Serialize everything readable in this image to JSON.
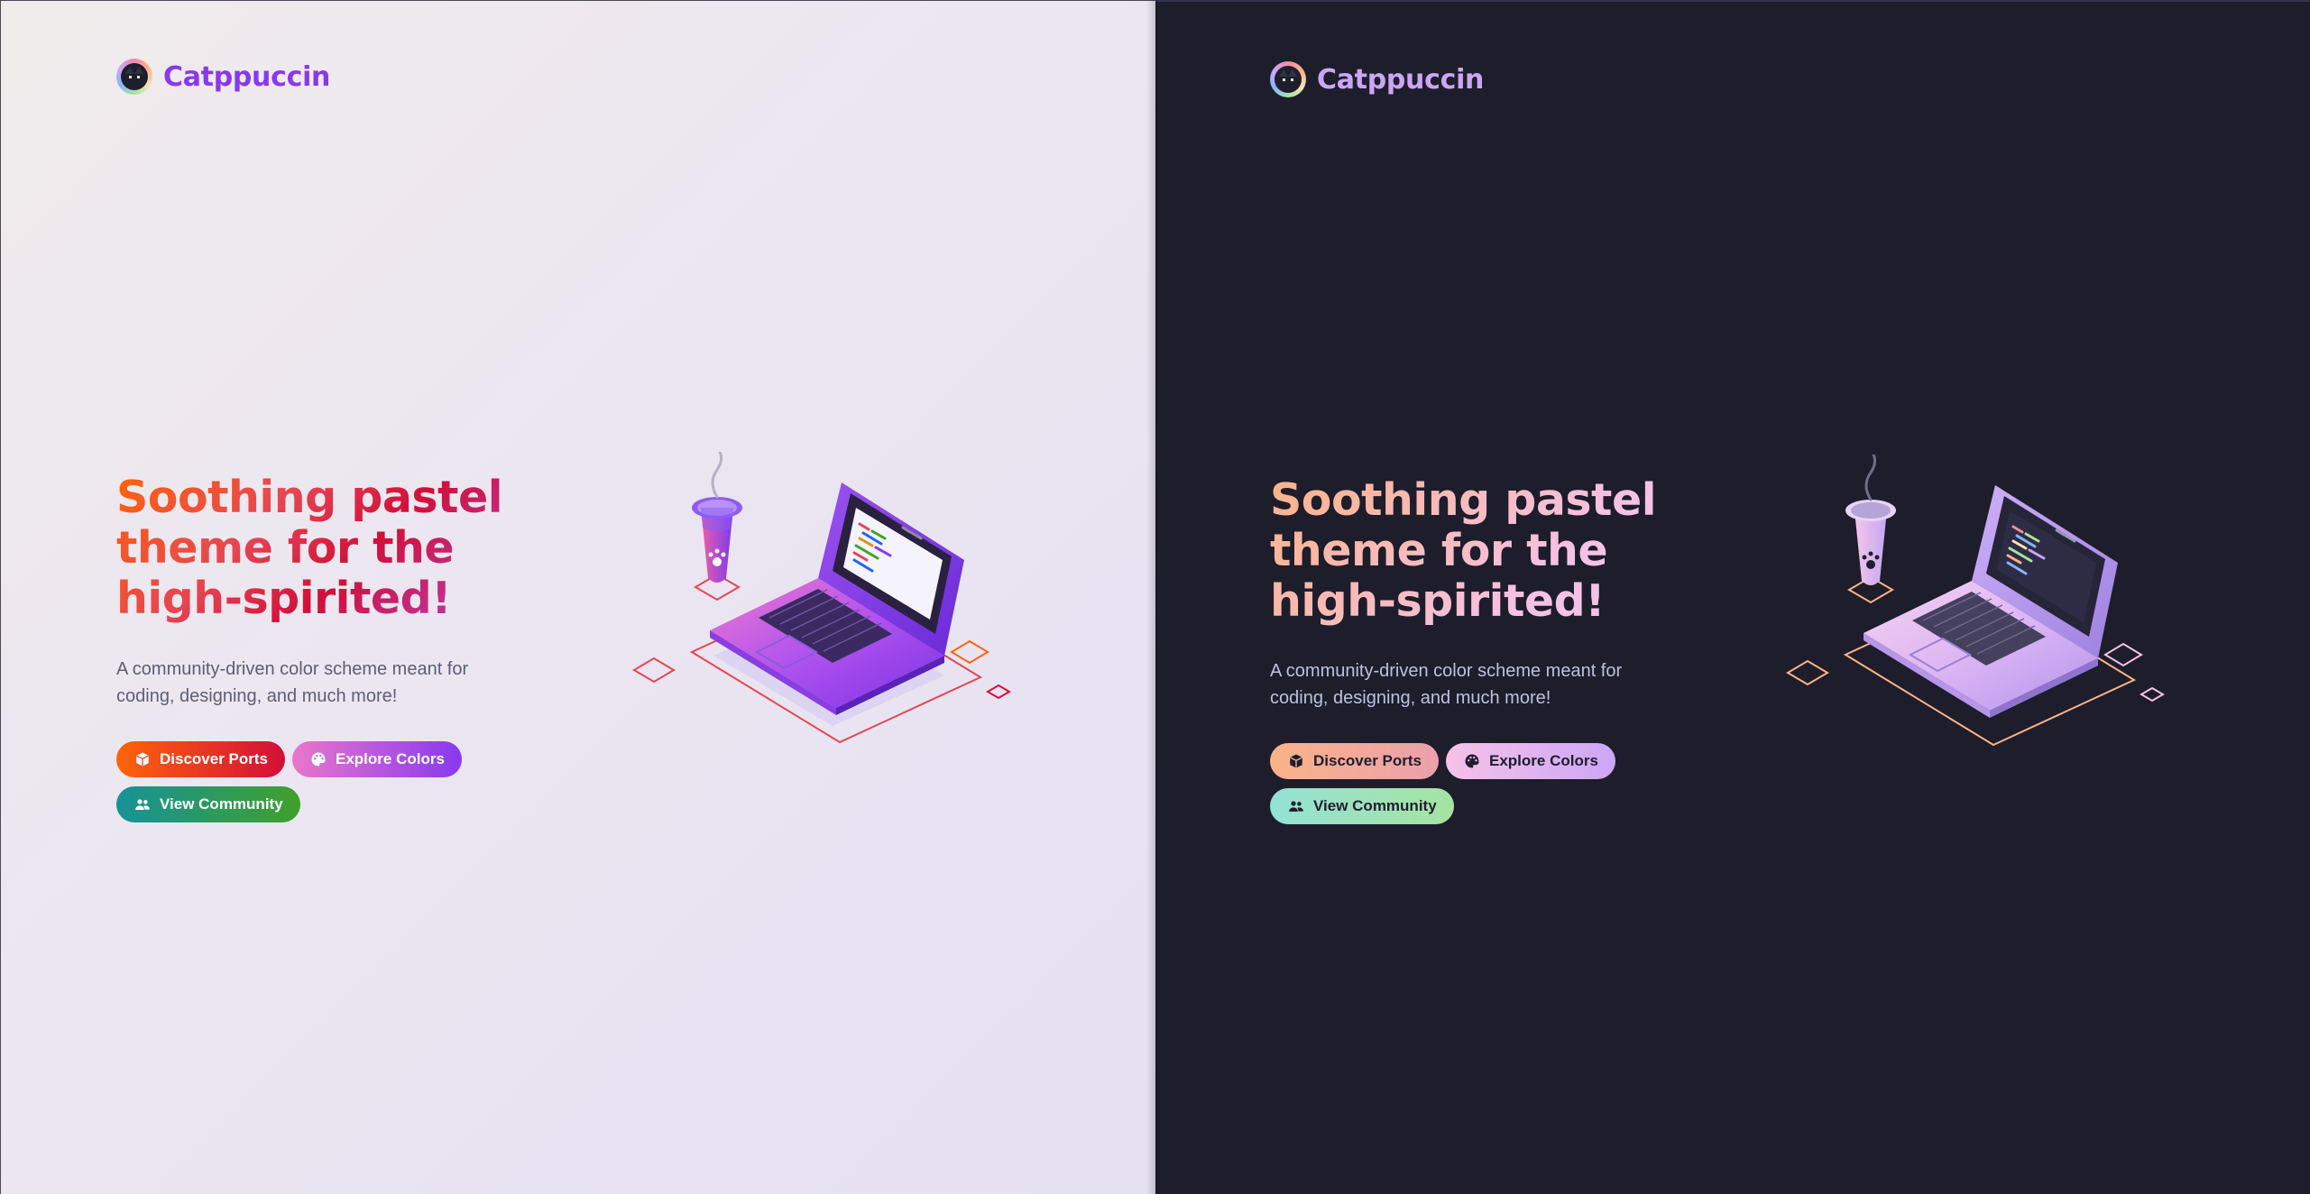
{
  "brand": {
    "name": "Catppuccin",
    "logo_icon": "catppuccin-cat-logo-icon"
  },
  "hero": {
    "headline_lines": [
      "Soothing pastel",
      "theme for the",
      "high-spirited!"
    ],
    "description_lines": [
      "A community-driven color scheme meant for",
      "coding, designing, and much more!"
    ]
  },
  "buttons": {
    "discover": {
      "label": "Discover Ports",
      "icon": "package-icon"
    },
    "explore": {
      "label": "Explore Colors",
      "icon": "palette-icon"
    },
    "community": {
      "label": "View Community",
      "icon": "users-icon"
    }
  },
  "themes": {
    "light": {
      "accent": "#8839ef",
      "base": "#eff1f5",
      "text": "#4c4f69",
      "peach": "#fe640b",
      "red": "#d20f39",
      "pink": "#ea76cb",
      "teal": "#179299",
      "green": "#40a02b"
    },
    "dark": {
      "accent": "#cba6f7",
      "base": "#1e1e2e",
      "text": "#cdd6f4",
      "peach": "#fab387",
      "maroon": "#eba0ac",
      "pink": "#f5c2e7",
      "teal": "#94e2d5",
      "green": "#a6e3a1"
    }
  }
}
